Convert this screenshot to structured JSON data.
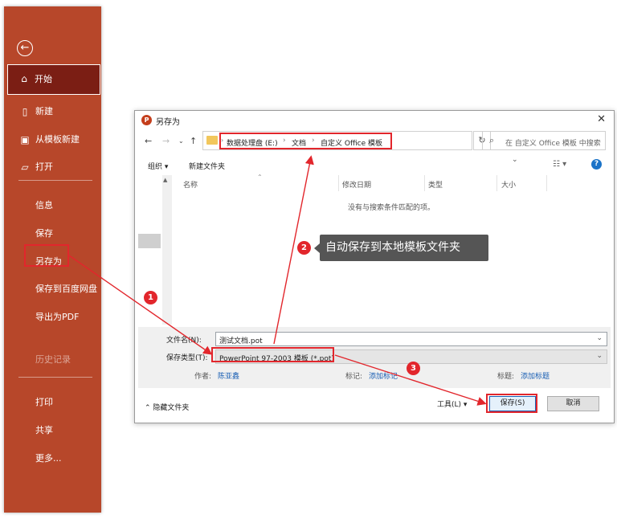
{
  "sidebar": {
    "back_icon": "back-arrow-icon",
    "items": [
      {
        "label": "开始",
        "icon": "home-icon"
      },
      {
        "label": "新建",
        "icon": "new-document-icon"
      },
      {
        "label": "从模板新建",
        "icon": "template-icon"
      },
      {
        "label": "打开",
        "icon": "folder-open-icon"
      },
      {
        "label": "信息"
      },
      {
        "label": "保存"
      },
      {
        "label": "另存为"
      },
      {
        "label": "保存到百度网盘"
      },
      {
        "label": "导出为PDF"
      },
      {
        "label": "历史记录"
      },
      {
        "label": "打印"
      },
      {
        "label": "共享"
      },
      {
        "label": "更多..."
      }
    ],
    "color": "#b7472a",
    "selected_color": "#7b1e14"
  },
  "dialog": {
    "title": "另存为",
    "app_icon_letter": "P",
    "close": "✕",
    "breadcrumb": [
      "数据处理盘 (E:)",
      "文档",
      "自定义 Office 模板"
    ],
    "search_placeholder": "在 自定义 Office 模板 中搜索",
    "toolbar": {
      "organize": "组织 ▾",
      "new_folder": "新建文件夹"
    },
    "columns": [
      "名称",
      "修改日期",
      "类型",
      "大小"
    ],
    "empty_message": "没有与搜索条件匹配的项。",
    "form": {
      "filename_label": "文件名(N):",
      "filename_value": "测试文档.pot",
      "filetype_label": "保存类型(T):",
      "filetype_value": "PowerPoint 97-2003 模板 (*.pot)",
      "author_label": "作者:",
      "author_value": "陈亚鑫",
      "tags_label": "标记:",
      "tags_value": "添加标记",
      "title_label": "标题:",
      "title_value": "添加标题"
    },
    "footer": {
      "hide_folders": "隐藏文件夹",
      "tools": "工具(L)",
      "save": "保存(S)",
      "cancel": "取消"
    }
  },
  "annotations": {
    "badges": [
      "1",
      "2",
      "3"
    ],
    "callout": "自动保存到本地模板文件夹",
    "color": "#e2262c"
  }
}
